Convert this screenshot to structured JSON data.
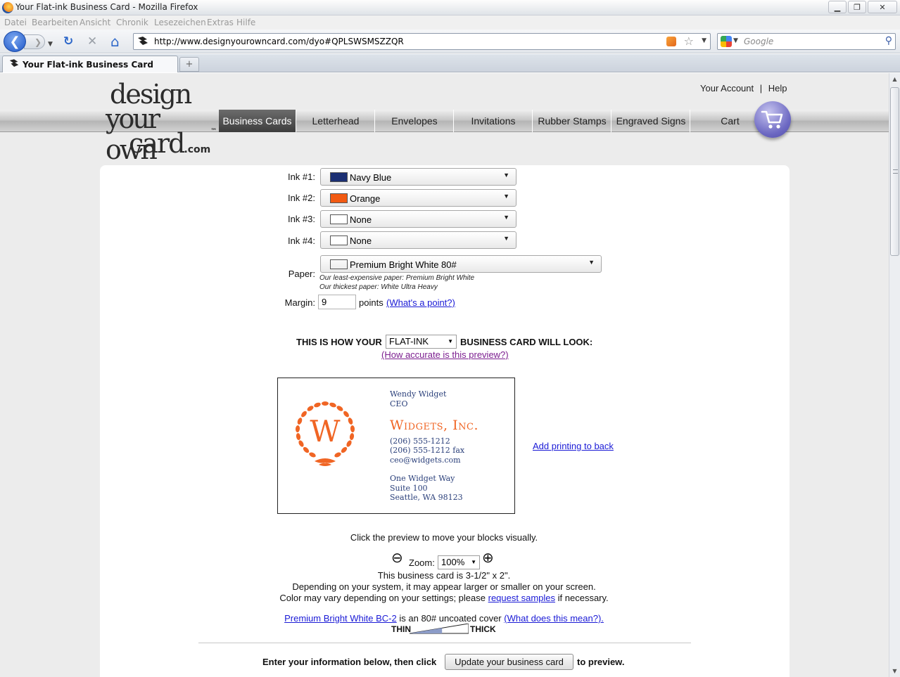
{
  "window": {
    "title": "Your Flat-ink Business Card - Mozilla Firefox",
    "controls": {
      "minimize": "▁",
      "maximize": "❐",
      "close": "✕"
    }
  },
  "menu": [
    "Datei",
    "Bearbeiten",
    "Ansicht",
    "Chronik",
    "Lesezeichen",
    "Extras",
    "Hilfe"
  ],
  "toolbar": {
    "url": "http://www.designyourowncard.com/dyo#QPLSWSMSZZQR",
    "search_placeholder": "Google",
    "back_glyph": "❮",
    "forward_glyph": "❯",
    "reload_glyph": "↻",
    "stop_glyph": "✕",
    "home_glyph": "⌂",
    "star_glyph": "☆",
    "dropdown_glyph": "▼",
    "search_glyph": "⚲"
  },
  "tabs": [
    {
      "title": "Your Flat-ink Business Card"
    }
  ],
  "newtab_glyph": "+",
  "site": {
    "logo": {
      "line1": "design",
      "line2": "your own",
      "line3": "card",
      "suffix": ".com",
      "tm": "™"
    },
    "account": {
      "your_account": "Your Account",
      "separator": "|",
      "help": "Help"
    },
    "nav": [
      "Business Cards",
      "Letterhead",
      "Envelopes",
      "Invitations",
      "Rubber Stamps",
      "Engraved Signs",
      "Cart"
    ],
    "nav_active": "Business Cards"
  },
  "form": {
    "inks": [
      {
        "label": "Ink #1:",
        "value": "Navy Blue",
        "color": "#1b2f73"
      },
      {
        "label": "Ink #2:",
        "value": "Orange",
        "color": "#f25a12"
      },
      {
        "label": "Ink #3:",
        "value": "None",
        "color": "#ffffff"
      },
      {
        "label": "Ink #4:",
        "value": "None",
        "color": "#ffffff"
      }
    ],
    "paper": {
      "label": "Paper:",
      "value": "Premium Bright White 80#",
      "note1": "Our least-expensive paper: Premium Bright White",
      "note2": "Our thickest paper: White Ultra Heavy"
    },
    "margin": {
      "label": "Margin:",
      "value": "9",
      "unit": "points",
      "help_link": "(What's a point?)"
    }
  },
  "preview": {
    "heading_before": "THIS IS HOW YOUR",
    "print_type": "FLAT-INK",
    "heading_after": "BUSINESS CARD WILL LOOK:",
    "accuracy_link": "(How accurate is this preview?)",
    "add_back_link": "Add printing to back",
    "instructions": "Click the preview to move your blocks visually.",
    "zoom_label": "Zoom:",
    "zoom_value": "100%",
    "zoom_out_glyph": "⊖",
    "zoom_in_glyph": "⊕",
    "size_text": "This business card is 3-1/2\" x 2\".",
    "system_text": "Depending on your system, it may appear larger or smaller on your screen.",
    "color_text_before": "Color may vary depending on your settings; please",
    "color_link": "request samples",
    "color_text_after": "if necessary.",
    "paper_link": "Premium Bright White BC-2",
    "paper_text": "is an 80# uncoated cover",
    "paper_help_link": "(What does this mean?).",
    "thin_label": "THIN",
    "thick_label": "THICK",
    "thickness_level": 0.55
  },
  "card": {
    "name": "Wendy Widget",
    "title": "CEO",
    "company": "Widgets, Inc.",
    "phone": "(206) 555-1212",
    "fax": "(206) 555-1212 fax",
    "email": "ceo@widgets.com",
    "address1": "One Widget Way",
    "address2": "Suite 100",
    "address3": "Seattle, WA 98123",
    "monogram": "W",
    "monogram_color": "#f06524"
  },
  "footer": {
    "before": "Enter your information below, then click",
    "button": "Update your business card",
    "after": "to preview."
  }
}
